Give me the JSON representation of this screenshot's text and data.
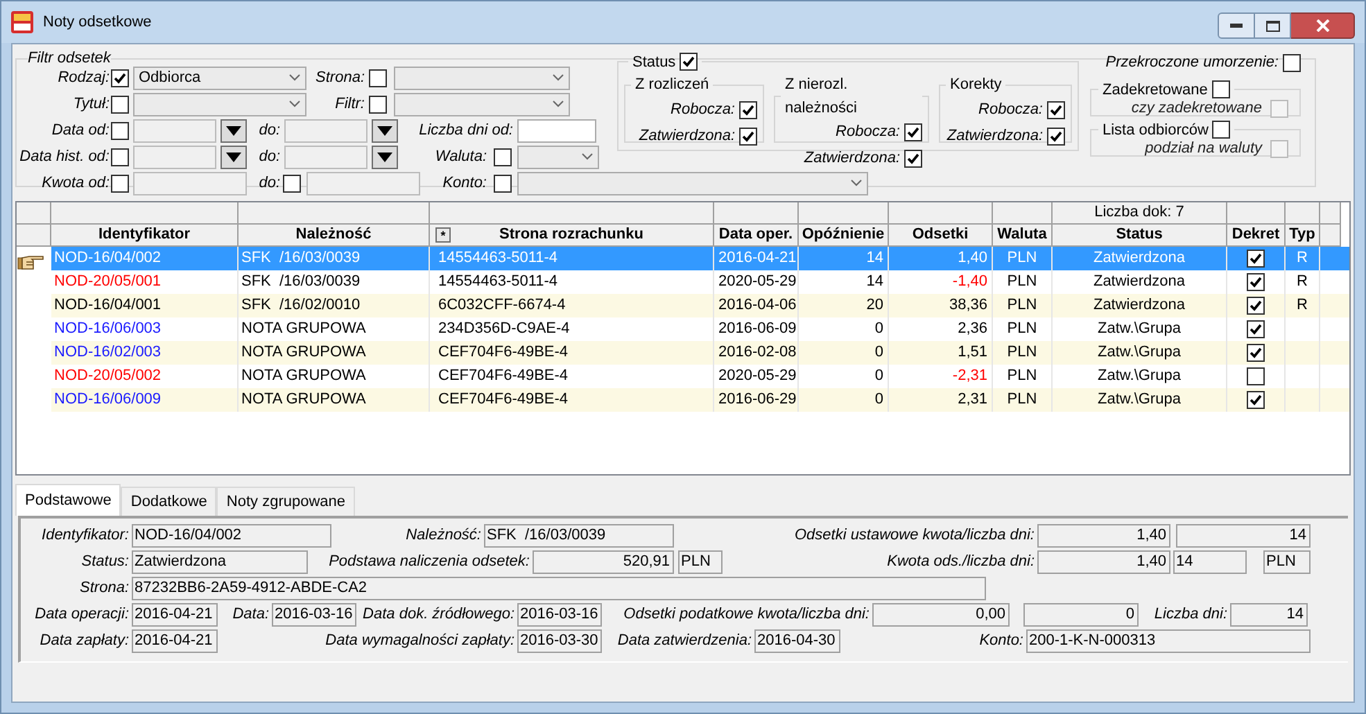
{
  "window": {
    "title": "Noty odsetkowe"
  },
  "filter": {
    "title": "Filtr odsetek",
    "rows": [
      [
        {
          "kind": "label",
          "text": "Rodzaj:"
        },
        {
          "kind": "checkbox",
          "checked": true
        },
        {
          "kind": "combo",
          "value": "Odbiorca"
        },
        {
          "kind": "label",
          "text": "Strona:"
        },
        {
          "kind": "checkbox",
          "checked": false
        },
        {
          "kind": "combo"
        }
      ],
      [
        {
          "kind": "label",
          "text": "Tytuł:"
        },
        {
          "kind": "checkbox",
          "checked": false
        },
        {
          "kind": "combo"
        },
        {
          "kind": "label",
          "text": "Filtr:"
        },
        {
          "kind": "checkbox",
          "checked": false
        },
        {
          "kind": "combo"
        }
      ],
      [
        {
          "kind": "label",
          "text": "Data od:"
        },
        {
          "kind": "checkbox",
          "checked": false
        },
        {
          "kind": "date"
        },
        {
          "kind": "label",
          "text": "do:"
        },
        {
          "kind": "date"
        },
        {
          "kind": "label",
          "text": "Liczba dni od:"
        },
        {
          "kind": "input"
        }
      ],
      [
        {
          "kind": "label",
          "text": "Data hist. od:"
        },
        {
          "kind": "checkbox",
          "checked": false
        },
        {
          "kind": "date"
        },
        {
          "kind": "label",
          "text": "do:"
        },
        {
          "kind": "date"
        },
        {
          "kind": "label",
          "text": "Waluta:"
        },
        {
          "kind": "checkbox",
          "checked": false
        },
        {
          "kind": "combo"
        }
      ],
      [
        {
          "kind": "label",
          "text": "Kwota od:"
        },
        {
          "kind": "checkbox",
          "checked": false
        },
        {
          "kind": "field"
        },
        {
          "kind": "label",
          "text": "do:"
        },
        {
          "kind": "checkbox",
          "checked": false
        },
        {
          "kind": "field"
        },
        {
          "kind": "label",
          "text": "Konto:"
        },
        {
          "kind": "checkbox",
          "checked": false
        },
        {
          "kind": "combo"
        }
      ]
    ],
    "status": {
      "label": "Status",
      "checked": true,
      "groups": [
        {
          "title": "Z rozliczeń",
          "options": [
            {
              "label": "Robocza:",
              "checked": true
            },
            {
              "label": "Zatwierdzona:",
              "checked": true
            }
          ]
        },
        {
          "title": "Z nierozl. należności",
          "options": [
            {
              "label": "Robocza:",
              "checked": true
            },
            {
              "label": "Zatwierdzona:",
              "checked": true
            }
          ]
        },
        {
          "title": "Korekty",
          "options": [
            {
              "label": "Robocza:",
              "checked": true
            },
            {
              "label": "Zatwierdzona:",
              "checked": true
            }
          ]
        }
      ]
    },
    "overdue": {
      "label": "Przekroczone umorzenie:",
      "checked": false
    },
    "subgroups": [
      {
        "title": "Zadekretowane",
        "checked": false,
        "option": {
          "label": "czy zadekretowane",
          "checked": false,
          "disabled": true
        }
      },
      {
        "title": "Lista odbiorców",
        "checked": false,
        "option": {
          "label": "podział na waluty",
          "checked": false,
          "disabled": true
        }
      }
    ]
  },
  "table": {
    "count_label": "Liczba dok: 7",
    "columns": [
      {
        "label": "Identyfikator"
      },
      {
        "label": "Należność"
      },
      {
        "label": "Strona rozrachunku",
        "button": "*"
      },
      {
        "label": "Data oper."
      },
      {
        "label": "Opóźnienie"
      },
      {
        "label": "Odsetki"
      },
      {
        "label": "Waluta"
      },
      {
        "label": "Status"
      },
      {
        "label": "Dekret"
      },
      {
        "label": "Typ"
      }
    ],
    "rows": [
      {
        "selected": true,
        "id": "NOD-16/04/002",
        "due": "SFK  /16/03/0039",
        "party": "14554463-5011-4",
        "date": "2016-04-21",
        "delay": "14",
        "amount": "1,40",
        "negative": false,
        "currency": "PLN",
        "status": "Zatwierdzona",
        "booked": true,
        "type": "R"
      },
      {
        "selected": false,
        "color": "#ff0000",
        "id": "NOD-20/05/001",
        "due": "SFK  /16/03/0039",
        "party": "14554463-5011-4",
        "date": "2020-05-29",
        "delay": "14",
        "amount": "-1,40",
        "negative": true,
        "currency": "PLN",
        "status": "Zatwierdzona",
        "booked": true,
        "type": "R"
      },
      {
        "selected": false,
        "color": "#000000",
        "id": "NOD-16/04/001",
        "due": "SFK  /16/02/0010",
        "party": "6C032CFF-6674-4",
        "date": "2016-04-06",
        "delay": "20",
        "amount": "38,36",
        "negative": false,
        "currency": "PLN",
        "status": "Zatwierdzona",
        "booked": true,
        "type": "R"
      },
      {
        "selected": false,
        "color": "#1a1aff",
        "id": "NOD-16/06/003",
        "due": "NOTA GRUPOWA",
        "party": "234D356D-C9AE-4",
        "date": "2016-06-09",
        "delay": "0",
        "amount": "2,36",
        "negative": false,
        "currency": "PLN",
        "status": "Zatw.\\Grupa",
        "booked": true
      },
      {
        "selected": false,
        "color": "#1a1aff",
        "id": "NOD-16/02/003",
        "due": "NOTA GRUPOWA",
        "party": "CEF704F6-49BE-4",
        "date": "2016-02-08",
        "delay": "0",
        "amount": "1,51",
        "negative": false,
        "currency": "PLN",
        "status": "Zatw.\\Grupa",
        "booked": true
      },
      {
        "selected": false,
        "color": "#ff0000",
        "id": "NOD-20/05/002",
        "due": "NOTA GRUPOWA",
        "party": "CEF704F6-49BE-4",
        "date": "2020-05-29",
        "delay": "0",
        "amount": "-2,31",
        "negative": true,
        "currency": "PLN",
        "status": "Zatw.\\Grupa",
        "booked": false
      },
      {
        "selected": false,
        "color": "#1a1aff",
        "id": "NOD-16/06/009",
        "due": "NOTA GRUPOWA",
        "party": "CEF704F6-49BE-4",
        "date": "2016-06-29",
        "delay": "0",
        "amount": "2,31",
        "negative": false,
        "currency": "PLN",
        "status": "Zatw.\\Grupa",
        "booked": true
      }
    ]
  },
  "tabs": [
    {
      "label": "Podstawowe",
      "selected": true
    },
    {
      "label": "Dodatkowe",
      "selected": false
    },
    {
      "label": "Noty zgrupowane",
      "selected": false
    }
  ],
  "details": [
    [
      {
        "kind": "label",
        "text": "Identyfikator:"
      },
      {
        "kind": "field",
        "text": "NOD-16/04/002"
      },
      {
        "kind": "label",
        "text": "Należność:"
      },
      {
        "kind": "field",
        "text": "SFK  /16/03/0039"
      },
      {
        "kind": "label",
        "text": "Odsetki ustawowe kwota/liczba dni:"
      },
      {
        "kind": "number",
        "text": "1,40"
      },
      {
        "kind": "number",
        "text": "14"
      }
    ],
    [
      {
        "kind": "label",
        "text": "Status:"
      },
      {
        "kind": "field",
        "text": "Zatwierdzona"
      },
      {
        "kind": "label",
        "text": "Podstawa naliczenia odsetek:"
      },
      {
        "kind": "number",
        "text": "520,91"
      },
      {
        "kind": "field",
        "text": "PLN"
      },
      {
        "kind": "label",
        "text": "Kwota ods./liczba dni:"
      },
      {
        "kind": "number",
        "text": "1,40"
      },
      {
        "kind": "field",
        "text": "14"
      },
      {
        "kind": "field",
        "text": "PLN"
      }
    ],
    [
      {
        "kind": "label",
        "text": "Strona:"
      },
      {
        "kind": "field",
        "text": "87232BB6-2A59-4912-ABDE-CA2"
      }
    ],
    [
      {
        "kind": "label",
        "text": "Data operacji:"
      },
      {
        "kind": "field",
        "text": "2016-04-21"
      },
      {
        "kind": "label",
        "text": "Data:"
      },
      {
        "kind": "field",
        "text": "2016-03-16"
      },
      {
        "kind": "label",
        "text": "Data dok. źródłowego:"
      },
      {
        "kind": "field",
        "text": "2016-03-16"
      },
      {
        "kind": "label",
        "text": "Odsetki podatkowe kwota/liczba dni:"
      },
      {
        "kind": "number",
        "text": "0,00"
      },
      {
        "kind": "number",
        "text": "0"
      },
      {
        "kind": "label",
        "text": "Liczba dni:"
      },
      {
        "kind": "number",
        "text": "14"
      }
    ],
    [
      {
        "kind": "label",
        "text": "Data zapłaty:"
      },
      {
        "kind": "field",
        "text": "2016-04-21"
      },
      {
        "kind": "label",
        "text": "Data wymagalności zapłaty:"
      },
      {
        "kind": "field",
        "text": "2016-03-30"
      },
      {
        "kind": "label",
        "text": "Data zatwierdzenia:"
      },
      {
        "kind": "field",
        "text": "2016-04-30"
      },
      {
        "kind": "label",
        "text": "Konto:"
      },
      {
        "kind": "field",
        "text": "200-1-K-N-000313"
      }
    ]
  ]
}
